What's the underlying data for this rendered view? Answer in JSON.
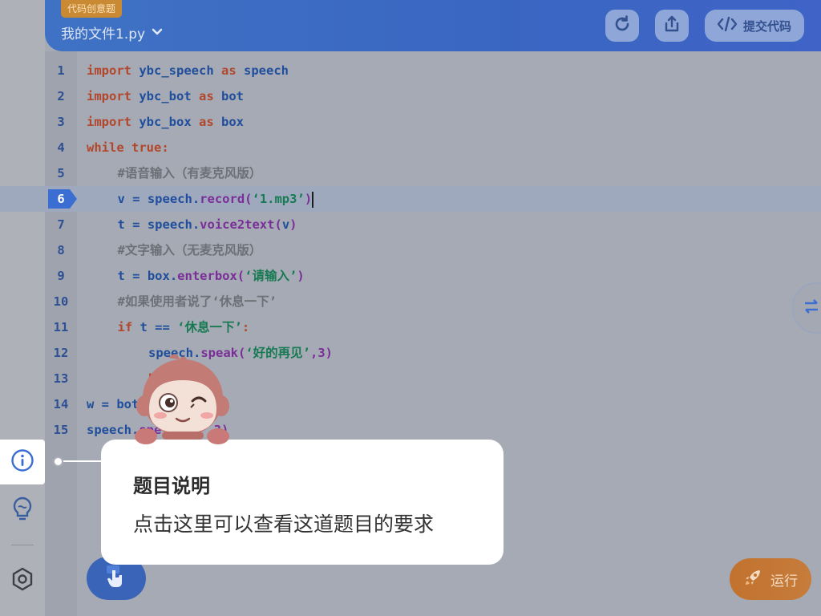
{
  "header": {
    "tag": "代码创意题",
    "filename": "我的文件1.py",
    "submit_label": "提交代码"
  },
  "editor": {
    "current_line": 6,
    "lines": [
      {
        "n": "1",
        "indent": 0,
        "tokens": [
          {
            "t": "import",
            "c": "kw"
          },
          {
            "t": " ybc_speech ",
            "c": "nm"
          },
          {
            "t": "as",
            "c": "kw"
          },
          {
            "t": " speech",
            "c": "nm"
          }
        ]
      },
      {
        "n": "2",
        "indent": 0,
        "tokens": [
          {
            "t": "import",
            "c": "kw"
          },
          {
            "t": " ybc_bot ",
            "c": "nm"
          },
          {
            "t": "as",
            "c": "kw"
          },
          {
            "t": " bot",
            "c": "nm"
          }
        ]
      },
      {
        "n": "3",
        "indent": 0,
        "tokens": [
          {
            "t": "import",
            "c": "kw"
          },
          {
            "t": " ybc_box ",
            "c": "nm"
          },
          {
            "t": "as",
            "c": "kw"
          },
          {
            "t": " box",
            "c": "nm"
          }
        ]
      },
      {
        "n": "4",
        "indent": 0,
        "tokens": [
          {
            "t": "while true:",
            "c": "kw"
          }
        ]
      },
      {
        "n": "5",
        "indent": 1,
        "tokens": [
          {
            "t": "#语音输入（有麦克风版）",
            "c": "cm"
          }
        ]
      },
      {
        "n": "6",
        "indent": 1,
        "tokens": [
          {
            "t": "v = speech.",
            "c": "nm"
          },
          {
            "t": "record(",
            "c": "fn"
          },
          {
            "t": "‘1.mp3’",
            "c": "st"
          },
          {
            "t": ")",
            "c": "fn"
          }
        ]
      },
      {
        "n": "7",
        "indent": 1,
        "tokens": [
          {
            "t": "t = speech.",
            "c": "nm"
          },
          {
            "t": "voice2text(",
            "c": "fn"
          },
          {
            "t": "v",
            "c": "nm"
          },
          {
            "t": ")",
            "c": "fn"
          }
        ]
      },
      {
        "n": "8",
        "indent": 1,
        "tokens": [
          {
            "t": "#文字输入（无麦克风版）",
            "c": "cm"
          }
        ]
      },
      {
        "n": "9",
        "indent": 1,
        "tokens": [
          {
            "t": "t = box.",
            "c": "nm"
          },
          {
            "t": "enterbox(",
            "c": "fn"
          },
          {
            "t": "‘请输入’",
            "c": "st"
          },
          {
            "t": ")",
            "c": "fn"
          }
        ]
      },
      {
        "n": "10",
        "indent": 1,
        "tokens": [
          {
            "t": "#如果使用者说了‘休息一下’",
            "c": "cm"
          }
        ]
      },
      {
        "n": "11",
        "indent": 1,
        "tokens": [
          {
            "t": "if",
            "c": "kw"
          },
          {
            "t": " t == ",
            "c": "nm"
          },
          {
            "t": "‘休息一下’",
            "c": "st"
          },
          {
            "t": ":",
            "c": "kw"
          }
        ]
      },
      {
        "n": "12",
        "indent": 2,
        "tokens": [
          {
            "t": "speech.",
            "c": "nm"
          },
          {
            "t": "speak(",
            "c": "fn"
          },
          {
            "t": "‘好的再见’",
            "c": "st"
          },
          {
            "t": ",3)",
            "c": "fn"
          }
        ]
      },
      {
        "n": "13",
        "indent": 2,
        "tokens": [
          {
            "t": "b",
            "c": "kw"
          }
        ]
      },
      {
        "n": "14",
        "indent": 0,
        "tokens": [
          {
            "t": "w = bot",
            "c": "nm"
          }
        ]
      },
      {
        "n": "15",
        "indent": 0,
        "tokens": [
          {
            "t": "speech.",
            "c": "nm"
          },
          {
            "t": "spe",
            "c": "fn"
          },
          {
            "t": "      ,3)",
            "c": "fn"
          }
        ]
      }
    ]
  },
  "tooltip": {
    "title": "题目说明",
    "body": "点击这里可以查看这道题目的要求"
  },
  "run_button": {
    "label": "运行"
  },
  "colors": {
    "accent_blue": "#3a6ed3",
    "run_orange": "#c2722f",
    "tag_orange": "#c98a33"
  },
  "icons": {
    "rail": [
      "info-icon",
      "lightbulb-icon",
      "settings-icon"
    ],
    "header": [
      "refresh-icon",
      "share-icon",
      "code-icon",
      "chevron-down-icon"
    ],
    "bottom": [
      "hand-tap-icon",
      "rocket-icon"
    ],
    "side": [
      "swap-icon"
    ]
  }
}
